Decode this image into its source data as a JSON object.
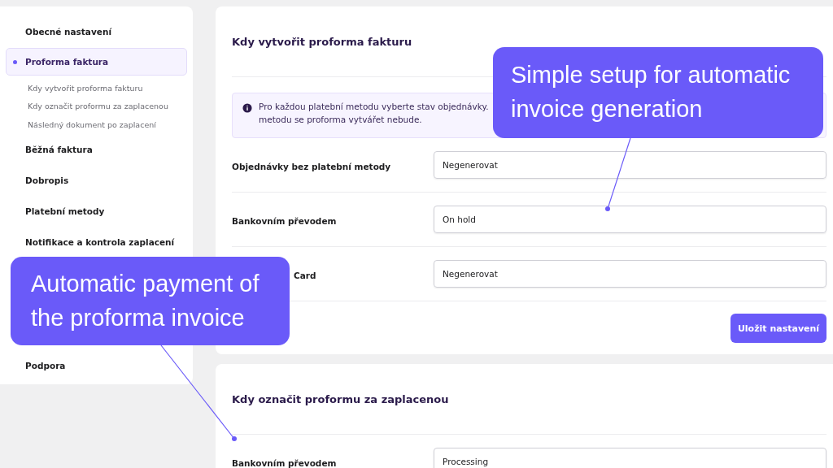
{
  "sidebar": {
    "items": [
      {
        "label": "Obecné nastavení",
        "selected": false
      },
      {
        "label": "Proforma faktura",
        "selected": true,
        "children": [
          {
            "label": "Kdy vytvořit proforma fakturu"
          },
          {
            "label": "Kdy označit proformu za zaplacenou"
          },
          {
            "label": "Následný dokument po zaplacení"
          }
        ]
      },
      {
        "label": "Běžná faktura",
        "selected": false
      },
      {
        "label": "Dobropis",
        "selected": false
      },
      {
        "label": "Platební metody",
        "selected": false
      },
      {
        "label": "Notifikace a kontrola zaplacení",
        "selected": false
      }
    ],
    "footer_item": {
      "label": "Podpora",
      "selected": false
    }
  },
  "sections": [
    {
      "title": "Kdy vytvořit proforma fakturu",
      "info": [
        "Pro každou platební metodu vyberte stav objednávky.",
        "metodu se proforma vytvářet nebude."
      ],
      "rows": [
        {
          "label": "Objednávky bez platební metody",
          "value": "Negenerovat"
        },
        {
          "label": "Bankovním převodem",
          "value": "On hold"
        },
        {
          "label": "Card",
          "value": "Negenerovat",
          "partly_covered": true
        }
      ],
      "save_button": "Uložit nastavení"
    },
    {
      "title": "Kdy označit proformu za zaplacenou",
      "rows": [
        {
          "label": "Bankovním převodem",
          "value": "Processing"
        }
      ]
    }
  ],
  "callouts": [
    {
      "text": "Simple setup for automatic invoice generation"
    },
    {
      "text": "Automatic payment of the proforma invoice"
    }
  ]
}
